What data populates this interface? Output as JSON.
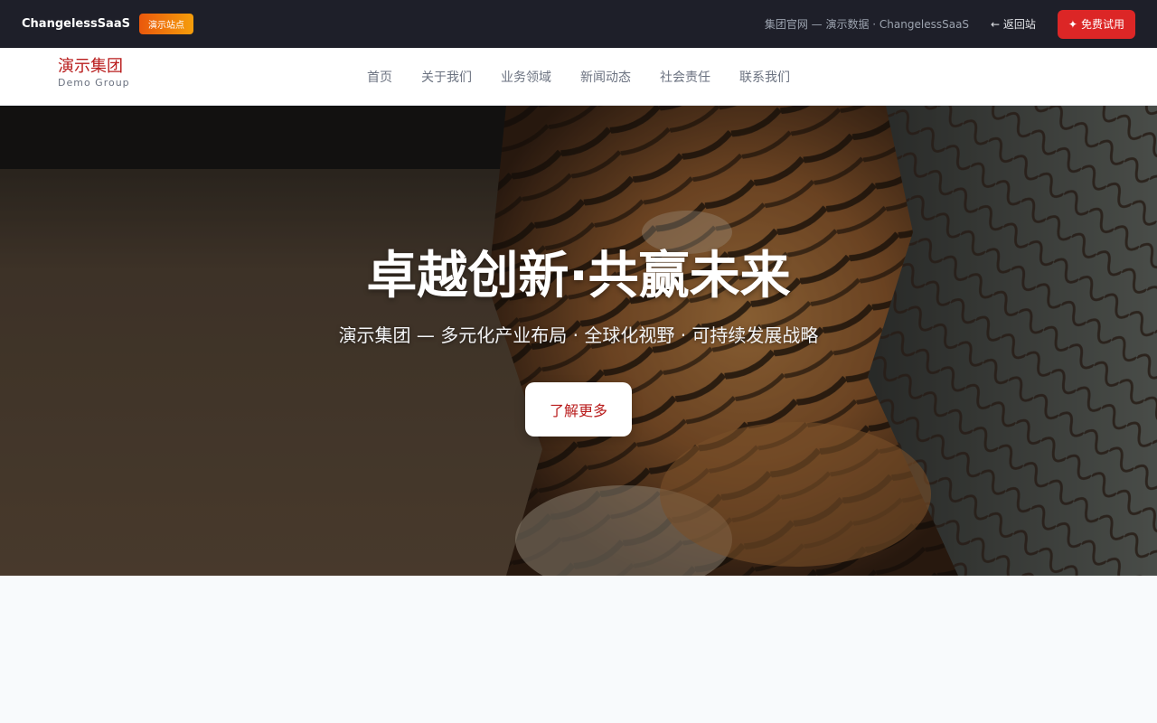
{
  "topbar": {
    "brand": "ChangelessSaaS",
    "badge": "演示站点",
    "info": "集团官网 — 演示数据 · ChangelessSaaS",
    "back_label": "← 返回站",
    "cta_label": "免费试用",
    "cta_icon": "spark-icon"
  },
  "nav": {
    "logo_name": "演示集团",
    "logo_sub": "Demo Group",
    "items": [
      "首页",
      "关于我们",
      "业务领域",
      "新闻动态",
      "社会责任",
      "联系我们"
    ]
  },
  "hero": {
    "title": "卓越创新·共赢未来",
    "subtitle": "演示集团 — 多元化产业布局 · 全球化视野 · 可持续发展战略",
    "button": "了解更多"
  },
  "colors": {
    "topbar_bg": "#1e1f29",
    "accent_red": "#dc2626",
    "brand_red": "#b91c1c",
    "badge_orange": "#f59e0b"
  }
}
